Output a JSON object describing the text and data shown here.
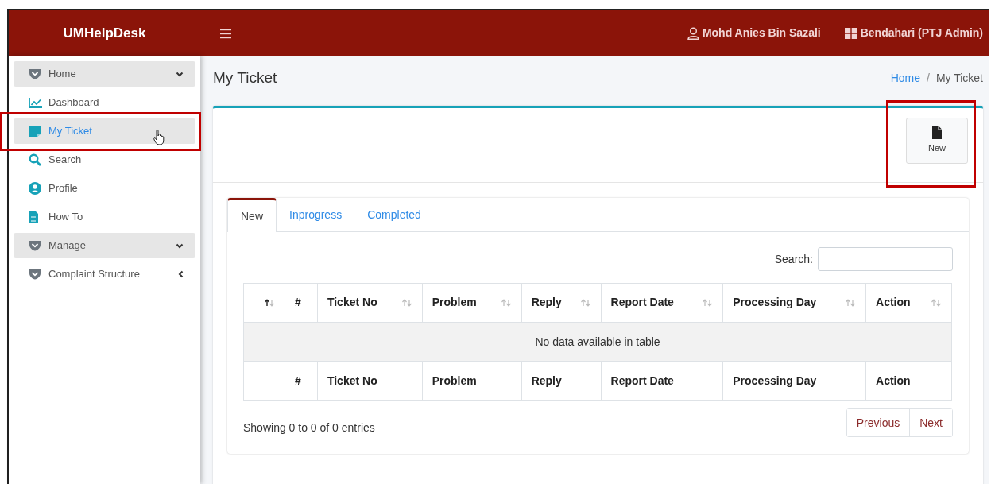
{
  "brand": "UMHelpDesk",
  "user": {
    "name": "Mohd Anies Bin Sazali",
    "role": "Bendahari (PTJ Admin)"
  },
  "sidebar": {
    "items": [
      {
        "kind": "group",
        "label": "Home",
        "expanded": true,
        "selected": false,
        "highlighted": false
      },
      {
        "kind": "link",
        "label": "Dashboard",
        "selected": false,
        "highlighted": false
      },
      {
        "kind": "link",
        "label": "My Ticket",
        "selected": true,
        "highlighted": true
      },
      {
        "kind": "link",
        "label": "Search",
        "selected": false,
        "highlighted": false
      },
      {
        "kind": "link",
        "label": "Profile",
        "selected": false,
        "highlighted": false
      },
      {
        "kind": "link",
        "label": "How To",
        "selected": false,
        "highlighted": false
      },
      {
        "kind": "group",
        "label": "Manage",
        "expanded": true,
        "selected": false,
        "highlighted": false
      },
      {
        "kind": "link",
        "label": "Complaint Structure",
        "expanded": false,
        "selected": false,
        "highlighted": false
      }
    ]
  },
  "page": {
    "title": "My Ticket",
    "breadcrumb": [
      {
        "label": "Home",
        "link": true
      },
      {
        "label": "My Ticket",
        "link": false
      }
    ],
    "breadcrumb_separator": "/"
  },
  "new_button": {
    "label": "New",
    "highlighted": true
  },
  "tabs": [
    {
      "label": "New",
      "selected": true
    },
    {
      "label": "Inprogress",
      "selected": false
    },
    {
      "label": "Completed",
      "selected": false
    }
  ],
  "search": {
    "label": "Search:"
  },
  "table": {
    "columns": [
      {
        "sortable": true,
        "sorted": true
      },
      {
        "label": "#",
        "sortable": false
      },
      {
        "label": "Ticket No",
        "sortable": true,
        "sorted": false
      },
      {
        "label": "Problem",
        "sortable": true,
        "sorted": false
      },
      {
        "label": "Reply",
        "sortable": true,
        "sorted": false
      },
      {
        "label": "Report Date",
        "sortable": true,
        "sorted": false
      },
      {
        "label": "Processing Day",
        "sortable": true,
        "sorted": false
      },
      {
        "label": "Action",
        "sortable": true,
        "sorted": false
      }
    ],
    "empty_message": "No data available in table",
    "footer_columns": [
      null,
      "#",
      "Ticket No",
      "Problem",
      "Reply",
      "Report Date",
      "Processing Day",
      "Action"
    ]
  },
  "info": "Showing 0 to 0 of 0 entries",
  "pagination": [
    "Previous",
    "Next"
  ]
}
